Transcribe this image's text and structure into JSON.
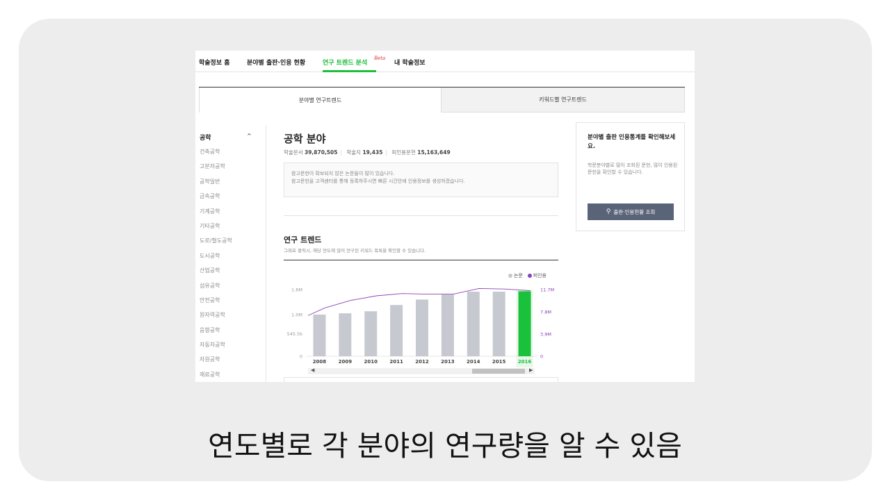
{
  "topnav": {
    "items": [
      "학술정보 홈",
      "분야별 출판·인용 현황",
      "연구 트렌드 분석",
      "내 학술정보"
    ],
    "beta": "Beta"
  },
  "tabs": [
    "분야별 연구트렌드",
    "키워드별 연구트렌드"
  ],
  "sidebar": {
    "header": "공학",
    "items": [
      "건축공학",
      "고분자공학",
      "공학일반",
      "금속공학",
      "기계공학",
      "기타공학",
      "도로/철도공학",
      "도시공학",
      "산업공학",
      "섬유공학",
      "안전공학",
      "원자력공학",
      "음향공학",
      "자동차공학",
      "자원공학",
      "재료공학"
    ]
  },
  "main": {
    "title": "공학 분야",
    "stats": {
      "papers_label": "학술문서",
      "papers_value": "39,870,505",
      "journals_label": "학술지",
      "journals_value": "19,435",
      "cited_label": "피인용문헌",
      "cited_value": "15,163,649"
    },
    "notice": [
      "참고문헌이 확보되지 않은 논문들이 많이 있습니다.",
      "참고문헌을 고객센터를 통해 등록하주시면 빠른 시간안에 인용정보를 생성하겠습니다."
    ]
  },
  "trend": {
    "title": "연구 트렌드",
    "subtitle": "그래프 클릭시, 해당 연도에 많이 연구된 키워드 목록을 확인할 수 있습니다.",
    "legend": [
      "논문",
      "피인용"
    ]
  },
  "side_card": {
    "title": "분야별 출판 인용통계를 확인해보세요.",
    "desc": "학문분야별로 많이 조회된 문헌, 많이 인용된 문헌을 확인할 수 있습니다.",
    "button": "출판·인용현황 조회"
  },
  "caption": "연도별로 각 분야의 연구량을 알 수 있음",
  "colors": {
    "accent": "#1dbf3a",
    "bar": "#c6c9cf",
    "bar_selected": "#19c23a",
    "line": "#8b3fb8",
    "button": "#5a6478"
  },
  "chart_data": {
    "type": "bar",
    "categories": [
      "2008",
      "2009",
      "2010",
      "2011",
      "2012",
      "2013",
      "2014",
      "2015",
      "2016"
    ],
    "series": [
      {
        "name": "논문",
        "values": [
          1000000,
          1030000,
          1080000,
          1230000,
          1360000,
          1480000,
          1550000,
          1550000,
          1560000
        ]
      },
      {
        "name": "피인용",
        "values": [
          8500000,
          9800000,
          10600000,
          11000000,
          10900000,
          10900000,
          11900000,
          11800000,
          11500000
        ]
      }
    ],
    "left_ticks": [
      "0",
      "545.5k",
      "1.0M",
      "1.6M"
    ],
    "left_tick_values": [
      0,
      545500,
      1000000,
      1600000
    ],
    "right_ticks": [
      "0",
      "3.9M",
      "7.8M",
      "11.7M"
    ],
    "right_tick_values": [
      0,
      3900000,
      7800000,
      11700000
    ],
    "ylim_left": [
      0,
      1600000
    ],
    "ylim_right": [
      0,
      11700000
    ],
    "selected": "2016"
  }
}
